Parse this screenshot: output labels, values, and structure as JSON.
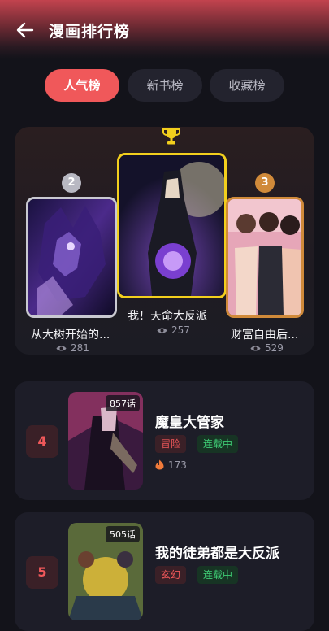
{
  "header": {
    "title": "漫画排行榜",
    "back_icon": "arrow-left-icon"
  },
  "tabs": [
    {
      "label": "人气榜",
      "active": true
    },
    {
      "label": "新书榜",
      "active": false
    },
    {
      "label": "收藏榜",
      "active": false
    }
  ],
  "podium": {
    "trophy_icon": "trophy-icon",
    "first": {
      "rank": "1",
      "name": "我！天命大反派",
      "views": "257",
      "border": "#f2cf1d"
    },
    "second": {
      "rank": "2",
      "name": "从大树开始的...",
      "views": "281",
      "border": "#c9c9d1"
    },
    "third": {
      "rank": "3",
      "name": "财富自由后...",
      "views": "529",
      "border": "#d08a3a"
    }
  },
  "list": [
    {
      "rank": "4",
      "title": "魔皇大管家",
      "chapters": "857话",
      "genre": "冒险",
      "status": "连载中",
      "heat": "173"
    },
    {
      "rank": "5",
      "title": "我的徒弟都是大反派",
      "chapters": "505话",
      "genre": "玄幻",
      "status": "连载中",
      "heat": ""
    }
  ],
  "colors": {
    "accent": "#f0585a",
    "gold": "#f2cf1d",
    "silver": "#c9c9d1",
    "bronze": "#d08a3a",
    "status_green": "#3ecb74"
  }
}
